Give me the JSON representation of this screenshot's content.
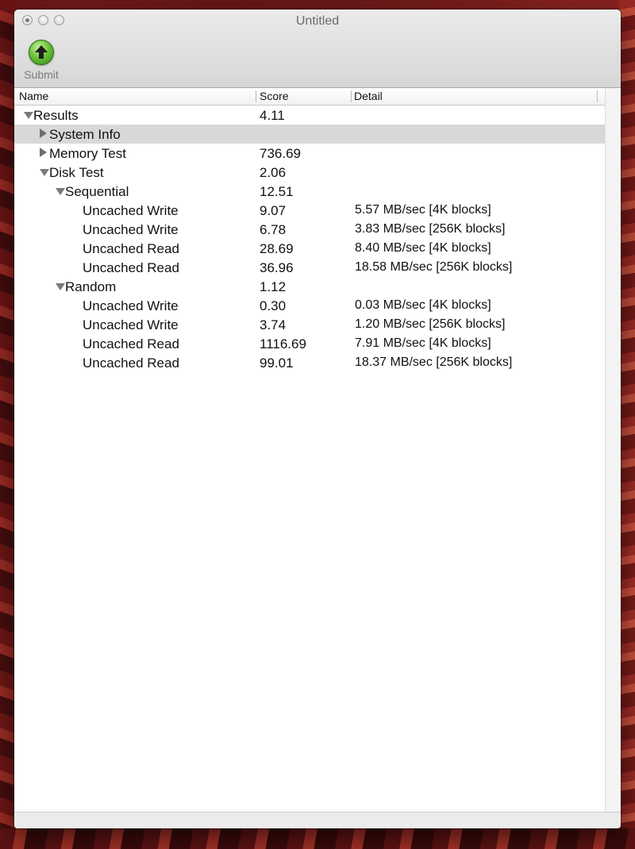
{
  "window": {
    "title": "Untitled"
  },
  "toolbar": {
    "submit_label": "Submit"
  },
  "columns": {
    "name": "Name",
    "score": "Score",
    "detail": "Detail"
  },
  "rows": [
    {
      "name": "Results",
      "score": "4.11",
      "detail": "",
      "level": 0,
      "disclosure": "expanded",
      "selected": false
    },
    {
      "name": "System Info",
      "score": "",
      "detail": "",
      "level": 1,
      "disclosure": "collapsed",
      "selected": true
    },
    {
      "name": "Memory Test",
      "score": "736.69",
      "detail": "",
      "level": 1,
      "disclosure": "collapsed",
      "selected": false
    },
    {
      "name": "Disk Test",
      "score": "2.06",
      "detail": "",
      "level": 1,
      "disclosure": "expanded",
      "selected": false
    },
    {
      "name": "Sequential",
      "score": "12.51",
      "detail": "",
      "level": 2,
      "disclosure": "expanded",
      "selected": false
    },
    {
      "name": "Uncached Write",
      "score": "9.07",
      "detail": "5.57 MB/sec [4K blocks]",
      "level": 3,
      "disclosure": "none",
      "selected": false
    },
    {
      "name": "Uncached Write",
      "score": "6.78",
      "detail": "3.83 MB/sec [256K blocks]",
      "level": 3,
      "disclosure": "none",
      "selected": false
    },
    {
      "name": "Uncached Read",
      "score": "28.69",
      "detail": "8.40 MB/sec [4K blocks]",
      "level": 3,
      "disclosure": "none",
      "selected": false
    },
    {
      "name": "Uncached Read",
      "score": "36.96",
      "detail": "18.58 MB/sec [256K blocks]",
      "level": 3,
      "disclosure": "none",
      "selected": false
    },
    {
      "name": "Random",
      "score": "1.12",
      "detail": "",
      "level": 2,
      "disclosure": "expanded",
      "selected": false
    },
    {
      "name": "Uncached Write",
      "score": "0.30",
      "detail": "0.03 MB/sec [4K blocks]",
      "level": 3,
      "disclosure": "none",
      "selected": false
    },
    {
      "name": "Uncached Write",
      "score": "3.74",
      "detail": "1.20 MB/sec [256K blocks]",
      "level": 3,
      "disclosure": "none",
      "selected": false
    },
    {
      "name": "Uncached Read",
      "score": "1116.69",
      "detail": "7.91 MB/sec [4K blocks]",
      "level": 3,
      "disclosure": "none",
      "selected": false
    },
    {
      "name": "Uncached Read",
      "score": "99.01",
      "detail": "18.37 MB/sec [256K blocks]",
      "level": 3,
      "disclosure": "none",
      "selected": false
    }
  ]
}
